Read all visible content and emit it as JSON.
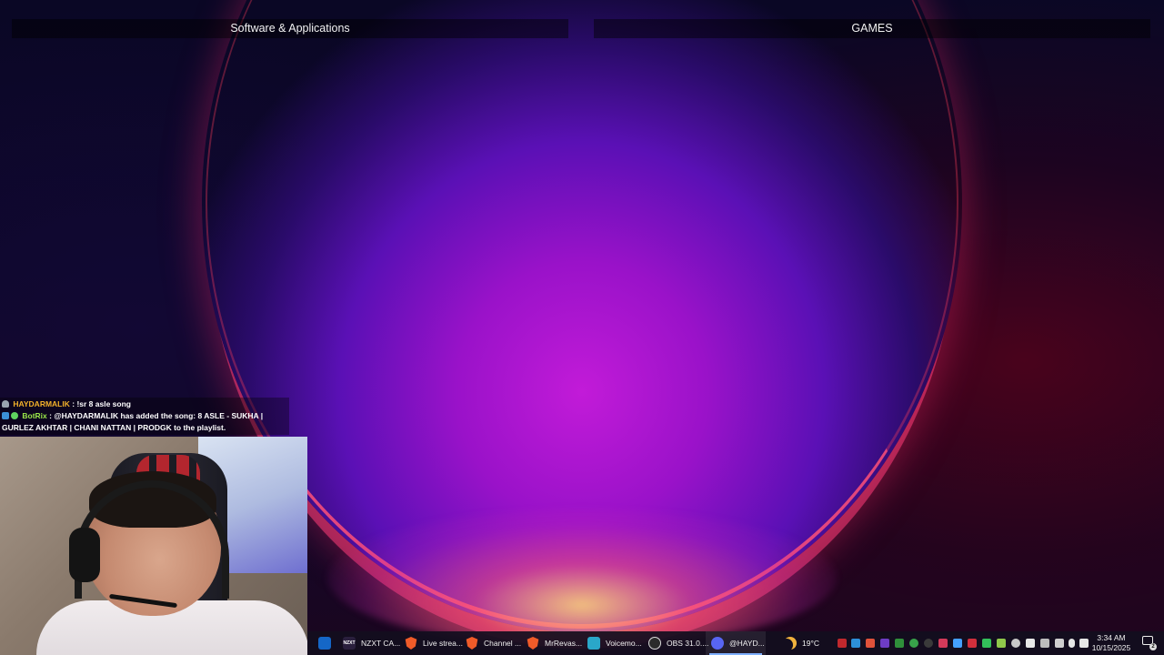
{
  "desktop": {
    "fences": [
      {
        "title": "Software & Applications"
      },
      {
        "title": "GAMES"
      }
    ]
  },
  "chat": {
    "messages": [
      {
        "user": "HAYDARMALIK",
        "sep": " : ",
        "text": "!sr 8 asle song",
        "user_color": "#f3b22a"
      },
      {
        "user": "BotRix",
        "sep": " : ",
        "text": "@HAYDARMALIK has added the song: 8 ASLE - SUKHA | GURLEZ AKHTAR | CHANI NATTAN | PRODGK to the playlist.",
        "user_color": "#9be84a"
      }
    ]
  },
  "taskbar": {
    "apps": [
      {
        "icon": "outlook-icon",
        "label": ""
      },
      {
        "icon": "nzxt-cam-icon",
        "icon_text": "NZXT",
        "label": "NZXT CA..."
      },
      {
        "icon": "brave-icon",
        "label": "Live strea..."
      },
      {
        "icon": "brave-icon",
        "label": "Channel ..."
      },
      {
        "icon": "brave-icon",
        "label": "MrRevas..."
      },
      {
        "icon": "voicemod-icon",
        "label": "Voicemo..."
      },
      {
        "icon": "obs-icon",
        "label": "OBS 31.0...."
      },
      {
        "icon": "discord-icon",
        "label": "@HAYD..."
      }
    ],
    "weather": {
      "icon": "moon-icon",
      "temperature": "19°C"
    },
    "clock": {
      "time": "3:34 AM",
      "date": "10/15/2025"
    },
    "notifications": {
      "count": "2"
    }
  },
  "colors": {
    "accent": "#7fb0ff",
    "brave": "#f05b29",
    "discord": "#5865f2"
  }
}
